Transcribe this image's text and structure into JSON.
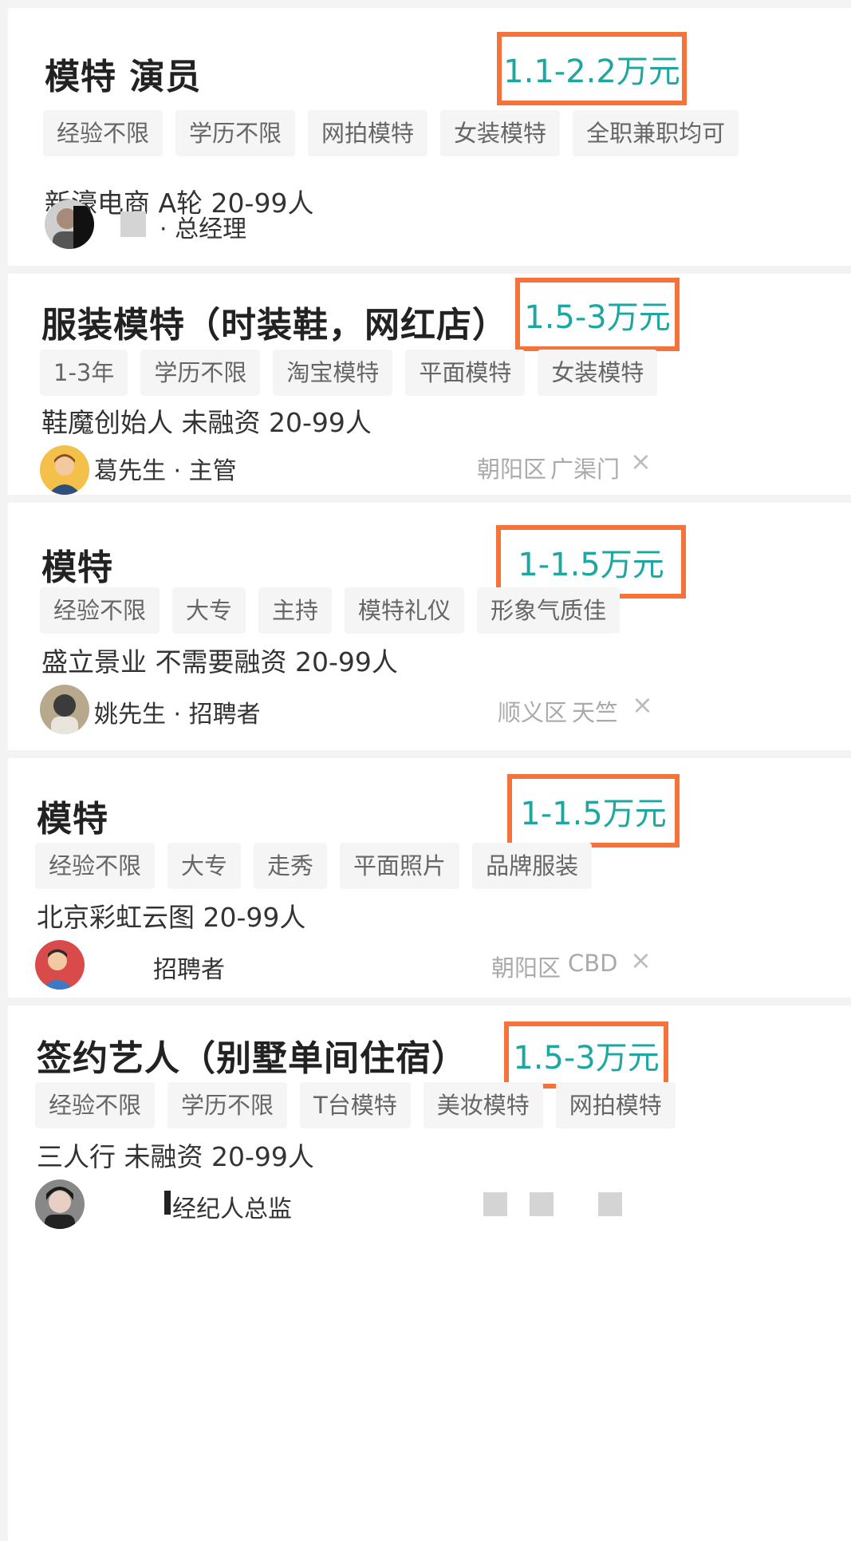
{
  "jobs": [
    {
      "title": "模特 演员",
      "salary": "1.1-2.2万元",
      "tags": [
        "经验不限",
        "学历不限",
        "网拍模特",
        "女装模特",
        "全职兼职均可"
      ],
      "company": "新濠电商 A轮 20-99人",
      "recruiter": "· 总经理"
    },
    {
      "title": "服装模特（时装鞋，网红店）",
      "salary": "1.5-3万元",
      "tags": [
        "1-3年",
        "学历不限",
        "淘宝模特",
        "平面模特",
        "女装模特"
      ],
      "company": "鞋魔创始人 未融资 20-99人",
      "recruiter": "葛先生 · 主管",
      "district": "朝阳区",
      "area": "广渠门",
      "close": "×"
    },
    {
      "title": "模特",
      "salary": "1-1.5万元",
      "tags": [
        "经验不限",
        "大专",
        "主持",
        "模特礼仪",
        "形象气质佳"
      ],
      "company": "盛立景业 不需要融资 20-99人",
      "recruiter": "姚先生 · 招聘者",
      "district": "顺义区",
      "area": "天竺",
      "close": "×"
    },
    {
      "title": "模特",
      "salary": "1-1.5万元",
      "tags": [
        "经验不限",
        "大专",
        "走秀",
        "平面照片",
        "品牌服装"
      ],
      "company": "北京彩虹云图  20-99人",
      "recruiter": "招聘者",
      "district": "朝阳区",
      "area": "CBD",
      "close": "×"
    },
    {
      "title": "签约艺人（别墅单间住宿）",
      "salary": "1.5-3万元",
      "tags": [
        "经验不限",
        "学历不限",
        "T台模特",
        "美妆模特",
        "网拍模特"
      ],
      "company": "三人行 未融资 20-99人",
      "recruiter": "经纪人总监"
    }
  ],
  "colors": {
    "salary": "#1ea7a1",
    "highlight_box": "#f5733b",
    "tag_bg": "#f5f5f5",
    "page_bg": "#f3f3f3"
  },
  "icons": [
    "avatar",
    "close-icon"
  ]
}
